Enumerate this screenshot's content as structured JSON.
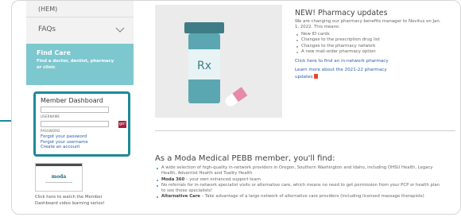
{
  "sidebar": {
    "hem_label": "(HEM)",
    "faqs_label": "FAQs",
    "find_care": {
      "title": "Find Care",
      "subtitle": "Find a doctor, dentist, pharmacy or clinic"
    },
    "member_dashboard": {
      "title": "Member Dashboard",
      "username_label": "USERNAME",
      "password_label": "PASSWORD",
      "go_label": "go!",
      "links": [
        "Forgot your password",
        "Forgot your username",
        "Create an account"
      ]
    },
    "video": {
      "logo_text": "moda",
      "caption": "Click here to watch the Member Dashboard video learning series!"
    }
  },
  "pharmacy": {
    "heading": "NEW! Pharmacy updates",
    "intro": "We are changing our pharmacy benefits manager to Novitus on Jan. 1, 2022. This means:",
    "bullets": [
      "New ID cards",
      "Changes to the prescription drug list",
      "Changes to the pharmacy network",
      "A new mail-order pharmacy option"
    ],
    "link1": "Click here to find an in-network pharmacy",
    "link2": "Learn more about the 2021-22 pharmacy updates",
    "image_label": "Rx"
  },
  "member_section": {
    "heading": "As a Moda Medical PEBB member, you'll find:",
    "bullets": [
      {
        "bold": "",
        "text": "A wide selection of high-quality in-network providers in Oregon, Southern Washington and Idaho, including OHSU Health, Legacy Health, Adventist Health and Tuality Health"
      },
      {
        "bold": "Moda 360",
        "text": " – your own enhanced support team"
      },
      {
        "bold": "",
        "text": "No referrals for in-network specialist visits or alternative care, which means no need to get permission from your PCP or health plan to see these specialists!"
      },
      {
        "bold": "Alternative Care",
        "text": " – Take advantage of a large network of alternative care providers (including licensed massage therapists)"
      }
    ]
  },
  "colors": {
    "accent": "#1d8a98",
    "find_care_bg": "#7dc7cf",
    "go_button": "#a6233d",
    "link": "#2b60a8"
  }
}
